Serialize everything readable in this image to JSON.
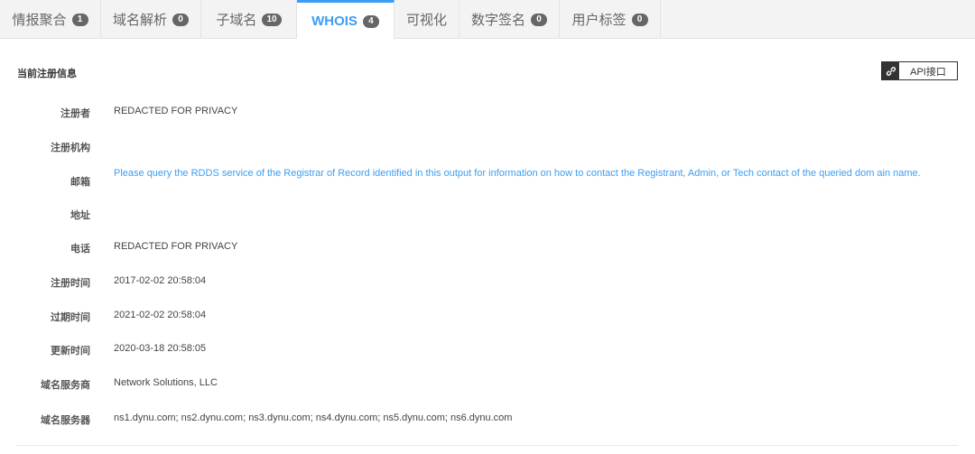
{
  "tabs": [
    {
      "label": "情报聚合",
      "count": "1"
    },
    {
      "label": "域名解析",
      "count": "0"
    },
    {
      "label": "子域名",
      "count": "10"
    },
    {
      "label": "WHOIS",
      "count": "4"
    },
    {
      "label": "可视化",
      "count": ""
    },
    {
      "label": "数字签名",
      "count": "0"
    },
    {
      "label": "用户标签",
      "count": "0"
    }
  ],
  "section": {
    "title": "当前注册信息",
    "api_button": "API接口"
  },
  "whois": {
    "registrant": {
      "label": "注册者",
      "value": "REDACTED FOR PRIVACY"
    },
    "registrar_org": {
      "label": "注册机构",
      "value": ""
    },
    "email": {
      "label": "邮箱",
      "value": "Please query the RDDS service of the Registrar of Record identified in this output for information on how to contact the Registrant, Admin, or Tech contact of the queried dom ain name."
    },
    "address": {
      "label": "地址",
      "value": ""
    },
    "phone": {
      "label": "电话",
      "value": "REDACTED FOR PRIVACY"
    },
    "created": {
      "label": "注册时间",
      "value": "2017-02-02 20:58:04"
    },
    "expires": {
      "label": "过期时间",
      "value": "2021-02-02 20:58:04"
    },
    "updated": {
      "label": "更新时间",
      "value": "2020-03-18 20:58:05"
    },
    "registrar": {
      "label": "域名服务商",
      "value": "Network Solutions, LLC"
    },
    "nameservers": {
      "label": "域名服务器",
      "value": "ns1.dynu.com; ns2.dynu.com; ns3.dynu.com; ns4.dynu.com; ns5.dynu.com; ns6.dynu.com"
    }
  },
  "colors": {
    "accent": "#3a9ef5",
    "badge": "#666666"
  }
}
